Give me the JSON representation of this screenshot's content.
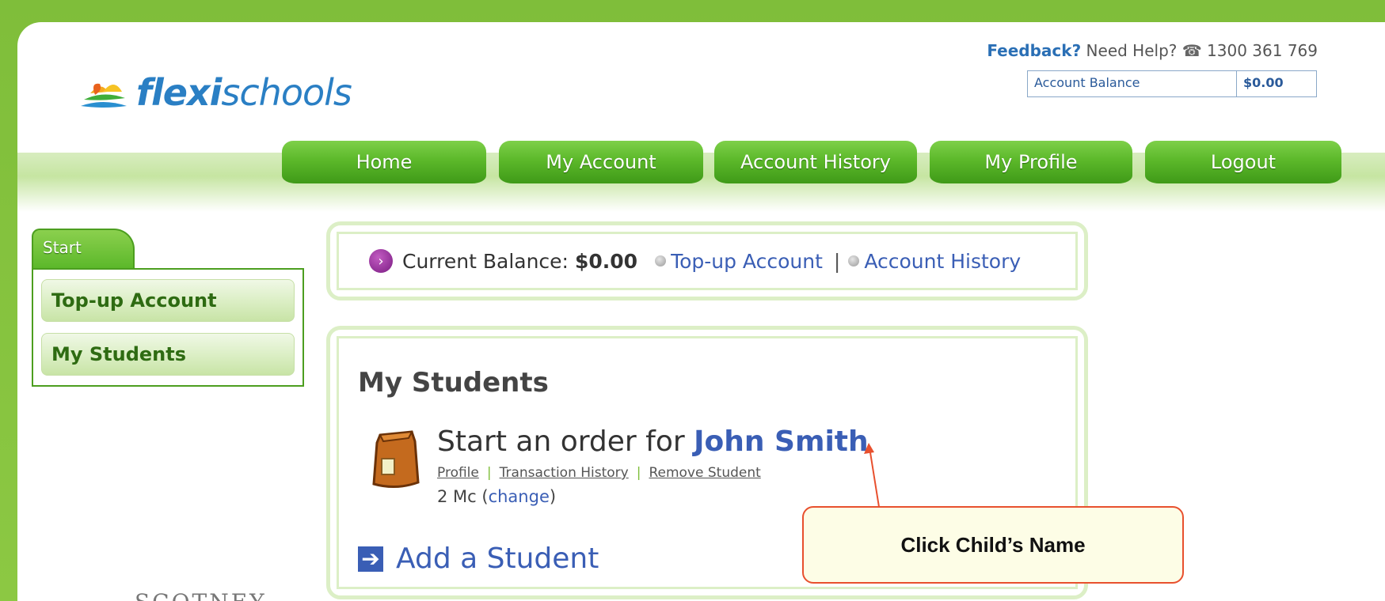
{
  "header": {
    "logo_bold": "flexi",
    "logo_light": "schools",
    "feedback": "Feedback?",
    "need_help": "Need Help?",
    "phone": "1300 361 769",
    "account_balance_label": "Account Balance",
    "account_balance_value": "$0.00"
  },
  "nav": {
    "tabs": [
      {
        "label": "Home"
      },
      {
        "label": "My Account"
      },
      {
        "label": "Account History"
      },
      {
        "label": "My Profile"
      },
      {
        "label": "Logout"
      }
    ]
  },
  "sidebar": {
    "tab_label": "Start",
    "items": [
      {
        "label": "Top-up Account"
      },
      {
        "label": "My Students"
      }
    ]
  },
  "balance_panel": {
    "label": "Current Balance:",
    "amount": "$0.00",
    "topup_link": "Top-up Account",
    "separator": "|",
    "history_link": "Account History"
  },
  "students": {
    "title": "My Students",
    "order_prefix": "Start an order for",
    "child_name": "John Smith",
    "links": {
      "profile": "Profile",
      "transactions": "Transaction History",
      "remove": "Remove Student"
    },
    "grade_text": "2 Mc",
    "change_link": "change",
    "add_student": "Add a Student"
  },
  "callout": {
    "text": "Click Child’s Name"
  },
  "footer": {
    "scotney": "SCOTNEY"
  },
  "colors": {
    "brand_green": "#7fbe3a",
    "tab_green": "#5cb82a",
    "link_blue": "#3a5eb5",
    "callout_border": "#e8502e"
  }
}
